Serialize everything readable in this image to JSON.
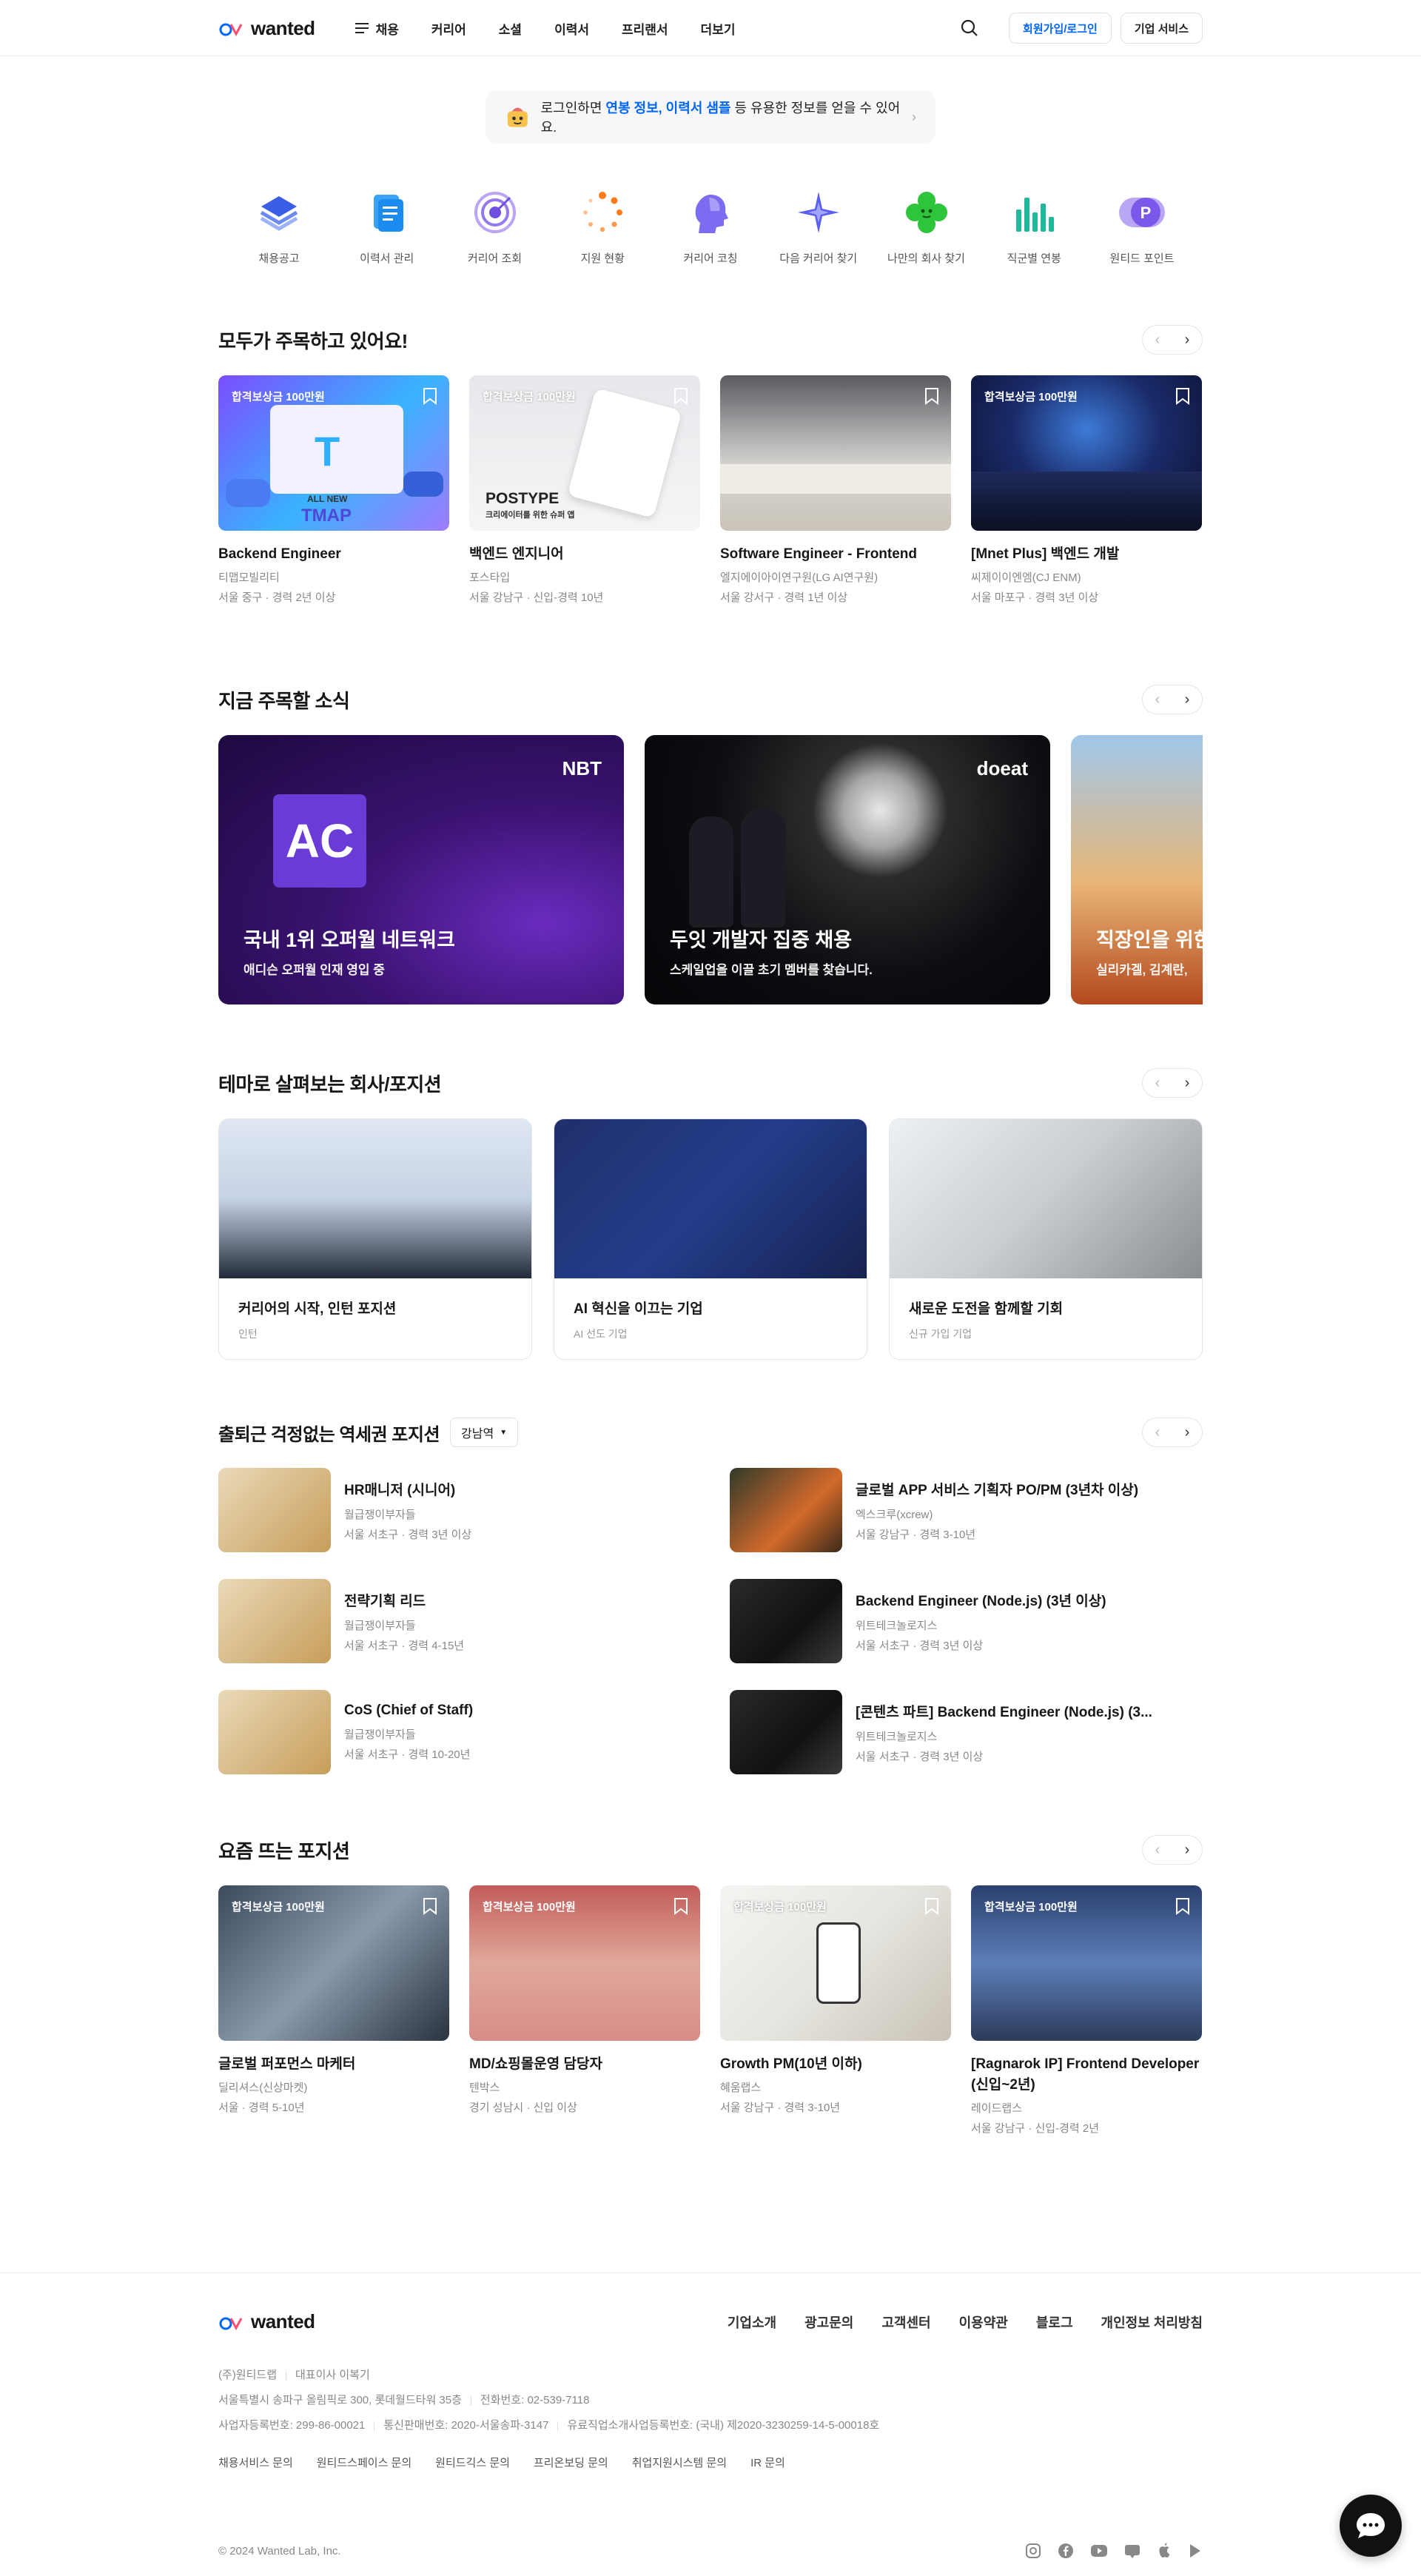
{
  "header": {
    "logo": "wanted",
    "nav": [
      "채용",
      "커리어",
      "소셜",
      "이력서",
      "프리랜서",
      "더보기"
    ],
    "signup": "회원가입/로그인",
    "company": "기업 서비스"
  },
  "banner": {
    "prefix": "로그인하면",
    "highlight": "연봉 정보, 이력서 샘플",
    "suffix": "등 유용한 정보를 얻을 수 있어요."
  },
  "quick": [
    {
      "label": "채용공고",
      "icon": "layers-icon"
    },
    {
      "label": "이력서 관리",
      "icon": "document-icon"
    },
    {
      "label": "커리어 조회",
      "icon": "target-icon"
    },
    {
      "label": "지원 현황",
      "icon": "loading-dots-icon"
    },
    {
      "label": "커리어 코칭",
      "icon": "head-icon"
    },
    {
      "label": "다음 커리어 찾기",
      "icon": "compass-star-icon"
    },
    {
      "label": "나만의 회사 찾기",
      "icon": "clover-face-icon"
    },
    {
      "label": "직군별 연봉",
      "icon": "bar-chart-icon"
    },
    {
      "label": "원티드 포인트",
      "icon": "point-icon"
    }
  ],
  "popular": {
    "title": "모두가 주목하고 있어요!",
    "badge": "합격보상금 100만원",
    "items": [
      {
        "title": "Backend Engineer",
        "company": "티맵모빌리티",
        "loc": "서울 중구 · 경력 2년 이상"
      },
      {
        "title": "백엔드 엔지니어",
        "company": "포스타입",
        "loc": "서울 강남구 · 신입-경력 10년"
      },
      {
        "title": "Software Engineer - Frontend",
        "company": "엘지에이아이연구원(LG AI연구원)",
        "loc": "서울 강서구 · 경력 1년 이상"
      },
      {
        "title": "[Mnet Plus] 백엔드 개발",
        "company": "씨제이이엔엠(CJ ENM)",
        "loc": "서울 마포구 · 경력 3년 이상"
      }
    ],
    "thumb_text": {
      "tmap_top": "ALL NEW",
      "tmap": "TMAP",
      "postype": "POSTYPE",
      "postype_sub": "크리에이터를 위한 슈퍼 앱"
    }
  },
  "news": {
    "title": "지금 주목할 소식",
    "items": [
      {
        "title": "국내 1위 오퍼월 네트워크",
        "sub": "애디슨 오퍼월 인재 영입 중",
        "brand": "NBT"
      },
      {
        "title": "두잇 개발자 집중 채용",
        "sub": "스케일업을 이끌 초기 멤버를 찾습니다.",
        "brand": "doeat"
      },
      {
        "title": "직장인을 위한",
        "sub": "실리카겔, 김계란,",
        "brand": ""
      }
    ]
  },
  "themes": {
    "title": "테마로 살펴보는 회사/포지션",
    "items": [
      {
        "title": "커리어의 시작, 인턴 포지션",
        "sub": "인턴"
      },
      {
        "title": "AI 혁신을 이끄는 기업",
        "sub": "AI 선도 기업"
      },
      {
        "title": "새로운 도전을 함께할 기회",
        "sub": "신규 가입 기업"
      }
    ]
  },
  "station": {
    "title": "출퇴근 걱정없는 역세권 포지션",
    "select": "강남역",
    "items": [
      {
        "title": "HR매니저 (시니어)",
        "company": "월급쟁이부자들",
        "loc": "서울 서초구 · 경력 3년 이상"
      },
      {
        "title": "글로벌 APP 서비스 기획자 PO/PM (3년차 이상)",
        "company": "엑스크루(xcrew)",
        "loc": "서울 강남구 · 경력 3-10년"
      },
      {
        "title": "전략기획 리드",
        "company": "월급쟁이부자들",
        "loc": "서울 서초구 · 경력 4-15년"
      },
      {
        "title": "Backend Engineer (Node.js) (3년 이상)",
        "company": "위트테크놀로지스",
        "loc": "서울 서초구 · 경력 3년 이상"
      },
      {
        "title": "CoS (Chief of Staff)",
        "company": "월급쟁이부자들",
        "loc": "서울 서초구 · 경력 10-20년"
      },
      {
        "title": "[콘텐츠 파트] Backend Engineer (Node.js) (3...",
        "company": "위트테크놀로지스",
        "loc": "서울 서초구 · 경력 3년 이상"
      }
    ]
  },
  "trending": {
    "title": "요즘 뜨는 포지션",
    "badge": "합격보상금 100만원",
    "items": [
      {
        "title": "글로벌 퍼포먼스 마케터",
        "company": "딜리셔스(신상마켓)",
        "loc": "서울 · 경력 5-10년"
      },
      {
        "title": "MD/쇼핑몰운영 담당자",
        "company": "텐박스",
        "loc": "경기 성남시 · 신입 이상"
      },
      {
        "title": "Growth PM(10년 이하)",
        "company": "혜움랩스",
        "loc": "서울 강남구 · 경력 3-10년"
      },
      {
        "title": "[Ragnarok IP] Frontend Developer (신입~2년)",
        "company": "레이드랩스",
        "loc": "서울 강남구 · 신입-경력 2년"
      }
    ]
  },
  "footer": {
    "logo": "wanted",
    "links": [
      "기업소개",
      "광고문의",
      "고객센터",
      "이용약관",
      "블로그",
      "개인정보 처리방침"
    ],
    "company": "(주)원티드랩",
    "ceo": "대표이사 이복기",
    "address": "서울특별시 송파구 올림픽로 300, 롯데월드타워 35층",
    "phone": "전화번호: 02-539-7118",
    "bizno": "사업자등록번호: 299-86-00021",
    "ecom": "통신판매번호: 2020-서울송파-3147",
    "job": "유료직업소개사업등록번호: (국내) 제2020-3230259-14-5-00018호",
    "bottom_links": [
      "채용서비스 문의",
      "원티드스페이스 문의",
      "원티드긱스 문의",
      "프리온보딩 문의",
      "취업지원시스템 문의",
      "IR 문의"
    ],
    "copyright": "© 2024 Wanted Lab, Inc."
  }
}
